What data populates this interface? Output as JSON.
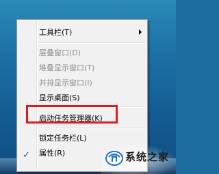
{
  "menu": {
    "items": [
      {
        "label": "工具栏(T)",
        "enabled": true,
        "submenu": true
      },
      {
        "label": "层叠窗口(D)",
        "enabled": false
      },
      {
        "label": "堆叠显示窗口(T)",
        "enabled": false
      },
      {
        "label": "并排显示窗口(I)",
        "enabled": false
      },
      {
        "label": "显示桌面(S)",
        "enabled": true
      },
      {
        "label": "启动任务管理器(K)",
        "enabled": true,
        "highlighted": true
      },
      {
        "label": "锁定任务栏(L)",
        "enabled": true,
        "checked": true
      },
      {
        "label": "属性(R)",
        "enabled": true
      }
    ]
  },
  "watermark": {
    "text": "系统之家"
  },
  "colors": {
    "highlight_border": "#e01a1a",
    "check_mark": "#1a5bb5",
    "desktop": "#1c6d9c"
  }
}
